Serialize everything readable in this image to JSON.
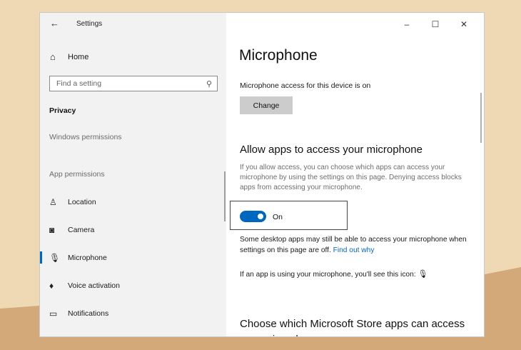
{
  "window": {
    "title": "Settings",
    "back_icon": "back-arrow-icon",
    "controls": {
      "minimize": "–",
      "maximize": "☐",
      "close": "✕"
    }
  },
  "sidebar": {
    "home_label": "Home",
    "search_placeholder": "Find a setting",
    "category": "Privacy",
    "windows_permissions_label": "Windows permissions",
    "app_permissions_label": "App permissions",
    "items": [
      {
        "label": "Location",
        "icon": "location-icon"
      },
      {
        "label": "Camera",
        "icon": "camera-icon"
      },
      {
        "label": "Microphone",
        "icon": "microphone-icon",
        "active": true
      },
      {
        "label": "Voice activation",
        "icon": "voice-activation-icon"
      },
      {
        "label": "Notifications",
        "icon": "notifications-icon"
      }
    ]
  },
  "main": {
    "title": "Microphone",
    "device_status": "Microphone access for this device is on",
    "change_button": "Change",
    "allow_heading": "Allow apps to access your microphone",
    "allow_description": "If you allow access, you can choose which apps can access your microphone by using the settings on this page. Denying access blocks apps from accessing your microphone.",
    "toggle_state": "On",
    "desktop_note": "Some desktop apps may still be able to access your microphone when settings on this page are off.",
    "find_out_link": "Find out why",
    "icon_note": "If an app is using your microphone, you'll see this icon:",
    "store_heading": "Choose which Microsoft Store apps can access your microphone"
  },
  "colors": {
    "accent": "#0067c0",
    "sidebar_bg": "#f2f2f2",
    "desktop_bg": "#efd9b4"
  }
}
